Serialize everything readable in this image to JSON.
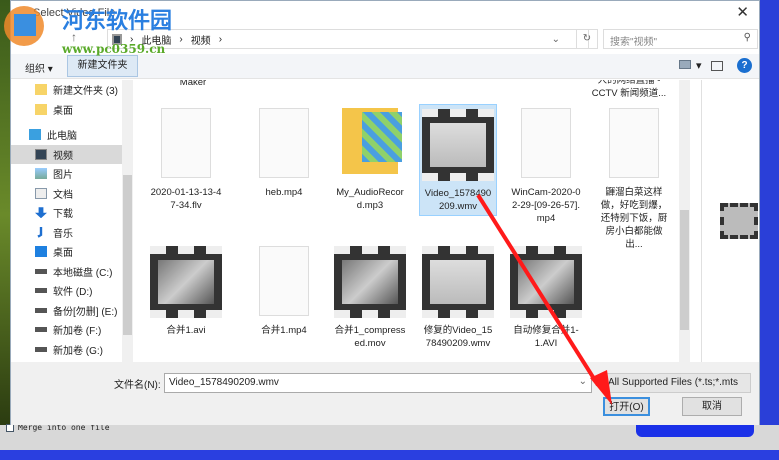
{
  "dialog": {
    "title": "Select Video File",
    "close": "✕"
  },
  "nav": {
    "back": "←",
    "up": "↑",
    "breadcrumb": [
      "此电脑",
      "视频"
    ],
    "sep": "›",
    "refresh": "↻",
    "dropdown": "⌄"
  },
  "search": {
    "placeholder": "搜索\"视频\"",
    "icon": "⚲"
  },
  "toolbar": {
    "organize": "组织 ▾",
    "new_folder": "新建文件夹",
    "view_dd": "▾",
    "help": "?"
  },
  "sidebar": {
    "items": [
      {
        "label": "新建文件夹 (3)",
        "icon": "folder-icon"
      },
      {
        "label": "桌面",
        "icon": "folder-icon"
      },
      {
        "label": "此电脑",
        "icon": "computer-icon"
      },
      {
        "label": "视频",
        "icon": "video-icon",
        "selected": true
      },
      {
        "label": "图片",
        "icon": "pictures-icon"
      },
      {
        "label": "文档",
        "icon": "documents-icon"
      },
      {
        "label": "下载",
        "icon": "download-icon"
      },
      {
        "label": "音乐",
        "icon": "music-icon"
      },
      {
        "label": "桌面",
        "icon": "desktop-icon"
      },
      {
        "label": "本地磁盘 (C:)",
        "icon": "drive-icon"
      },
      {
        "label": "软件 (D:)",
        "icon": "drive-icon"
      },
      {
        "label": "备份[勿删] (E:)",
        "icon": "drive-icon"
      },
      {
        "label": "新加卷 (F:)",
        "icon": "drive-icon"
      },
      {
        "label": "新加卷 (G:)",
        "icon": "drive-icon"
      }
    ]
  },
  "files": {
    "top_partial": [
      "Maker",
      "人的网络直播 - CCTV 新闻频道..."
    ],
    "row1": [
      {
        "name": "2020-01-13-13-47-34.flv",
        "type": "doc"
      },
      {
        "name": "heb.mp4",
        "type": "doc"
      },
      {
        "name": "My_AudioRecord.mp3",
        "type": "folder"
      },
      {
        "name": "Video_1578490209.wmv",
        "type": "film-light",
        "selected": true
      },
      {
        "name": "WinCam-2020-02-29-[09-26-57].mp4",
        "type": "doc"
      },
      {
        "name": "鼲溜白菜这样做，好吃到爆，还特别下饭，厨房小白都能做出...",
        "type": "doc"
      }
    ],
    "row2": [
      {
        "name": "合并1.avi",
        "type": "film"
      },
      {
        "name": "合并1.mp4",
        "type": "doc"
      },
      {
        "name": "合并1_compressed.mov",
        "type": "film"
      },
      {
        "name": "修复的Video_1578490209.wmv",
        "type": "film-light"
      },
      {
        "name": "自动修复合并1-1.AVI",
        "type": "film"
      }
    ]
  },
  "bottom": {
    "filename_label": "文件名(N):",
    "filename": "Video_1578490209.wmv",
    "filetype": "All Supported Files (*.ts;*.mts",
    "open": "打开(O)",
    "cancel": "取消"
  },
  "background": {
    "merge_label": "Merge into one file"
  },
  "watermark": {
    "name": "河东软件园",
    "url": "www.pc0359.cn"
  },
  "colors": {
    "accent": "#1a6fd0",
    "selection": "#cce4f7",
    "arrow": "#ff1a1a"
  }
}
